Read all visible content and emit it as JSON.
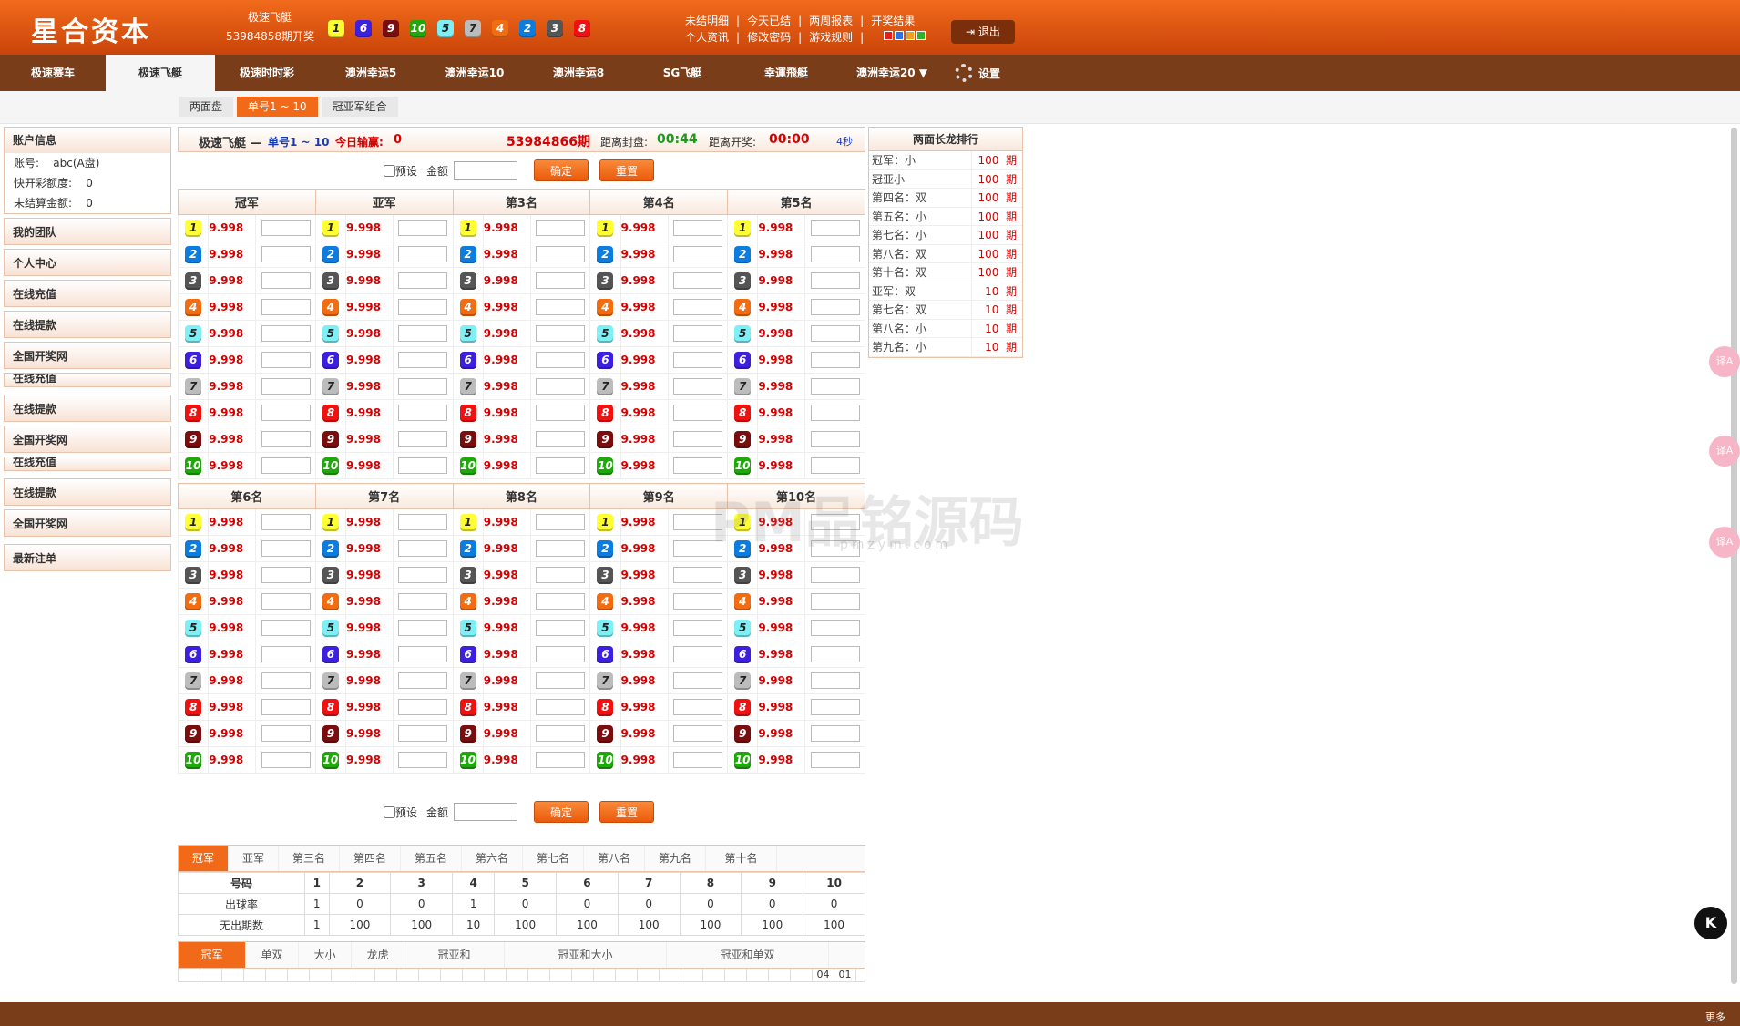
{
  "header": {
    "logo": "星合资本",
    "game_name": "极速飞艇",
    "issue_text": "53984858期开奖",
    "last_numbers": [
      "1",
      "6",
      "9",
      "10",
      "5",
      "7",
      "4",
      "2",
      "3",
      "8"
    ],
    "links_row1": [
      "未结明细",
      "|",
      "今天已结",
      "|",
      "两周报表",
      "|",
      "开奖结果"
    ],
    "links_row2": [
      "个人资讯",
      "|",
      "修改密码",
      "|",
      "游戏规则",
      "|"
    ],
    "color_squares": [
      "#e02020",
      "#3070e0",
      "#f0a020",
      "#30b030"
    ],
    "logout_label": "退出",
    "logout_icon": "logout-icon"
  },
  "nav": {
    "items": [
      "极速赛车",
      "极速飞艇",
      "极速时时彩",
      "澳洲幸运5",
      "澳洲幸运10",
      "澳洲幸运8",
      "SG飞艇",
      "幸運飛艇",
      "澳洲幸运20 ▼"
    ],
    "active": 1,
    "settings_label": "设置",
    "settings_icon": "gear-icon"
  },
  "subtabs": [
    "两面盘",
    "单号1 ~ 10",
    "冠亚军组合"
  ],
  "sidebar": {
    "account_title": "账户信息",
    "account_lines": [
      "账号:    abc(A盘)",
      "快开彩额度:    0",
      "未结算金额:    0"
    ],
    "menu": [
      {
        "label": "我的团队"
      },
      {
        "label": "个人中心"
      },
      {
        "label": "在线充值"
      },
      {
        "label": "在线提款"
      },
      {
        "label": "全国开奖网"
      },
      {
        "label": "在线充值",
        "cut": true
      },
      {
        "label": "在线提款"
      },
      {
        "label": "全国开奖网"
      },
      {
        "label": "在线充值",
        "cut": true
      },
      {
        "label": "在线提款"
      },
      {
        "label": "全国开奖网"
      },
      {
        "label": "最新注单"
      }
    ]
  },
  "infobar": {
    "game": "极速飞艇 —",
    "mode": "单号1 ~ 10",
    "today_label": "今日输赢:",
    "today_value": "0",
    "issue": "53984866期",
    "close_label": "距离封盘:",
    "close_time": "00:44",
    "draw_label": "距离开奖:",
    "draw_time": "00:00",
    "refresh": "4秒"
  },
  "controls": {
    "preset_label": "预设",
    "amount_label": "金额",
    "confirm": "确定",
    "reset": "重置"
  },
  "odds": {
    "positions_top": [
      "冠军",
      "亚军",
      "第3名",
      "第4名",
      "第5名"
    ],
    "positions_bottom": [
      "第6名",
      "第7名",
      "第8名",
      "第9名",
      "第10名"
    ],
    "value": "9.998",
    "numbers": [
      "1",
      "2",
      "3",
      "4",
      "5",
      "6",
      "7",
      "8",
      "9",
      "10"
    ]
  },
  "trend": {
    "tabs": [
      "冠军",
      "亚军",
      "第三名",
      "第四名",
      "第五名",
      "第六名",
      "第七名",
      "第八名",
      "第九名",
      "第十名"
    ],
    "header": [
      "号码",
      "1",
      "2",
      "3",
      "4",
      "5",
      "6",
      "7",
      "8",
      "9",
      "10"
    ],
    "rows": [
      [
        "出球率",
        "1",
        "0",
        "0",
        "1",
        "0",
        "0",
        "0",
        "0",
        "0",
        "0"
      ],
      [
        "无出期数",
        "1",
        "100",
        "100",
        "10",
        "100",
        "100",
        "100",
        "100",
        "100",
        "100"
      ]
    ],
    "tabs2": [
      "冠军",
      "单双",
      "大小",
      "龙虎",
      "冠亚和",
      "冠亚和大小",
      "冠亚和单双"
    ],
    "last_cells": [
      "04",
      "01"
    ]
  },
  "rank": {
    "title": "两面长龙排行",
    "rows": [
      {
        "name": "冠军：小",
        "val": "100  期"
      },
      {
        "name": "冠亚小",
        "val": "100  期"
      },
      {
        "name": "第四名：双",
        "val": "100  期"
      },
      {
        "name": "第五名：小",
        "val": "100  期"
      },
      {
        "name": "第七名：小",
        "val": "100  期"
      },
      {
        "name": "第八名：双",
        "val": "100  期"
      },
      {
        "name": "第十名：双",
        "val": "100  期"
      },
      {
        "name": "亚军：双",
        "val": "10  期"
      },
      {
        "name": "第七名：双",
        "val": "10  期"
      },
      {
        "name": "第八名：小",
        "val": "10  期"
      },
      {
        "name": "第九名：小",
        "val": "10  期"
      }
    ]
  },
  "footer": {
    "more": "更多"
  },
  "floating": {
    "hbtn": "K",
    "bubble": "译A"
  },
  "watermark": {
    "text": "PM品铭源码",
    "sub": "pmzym.com"
  }
}
